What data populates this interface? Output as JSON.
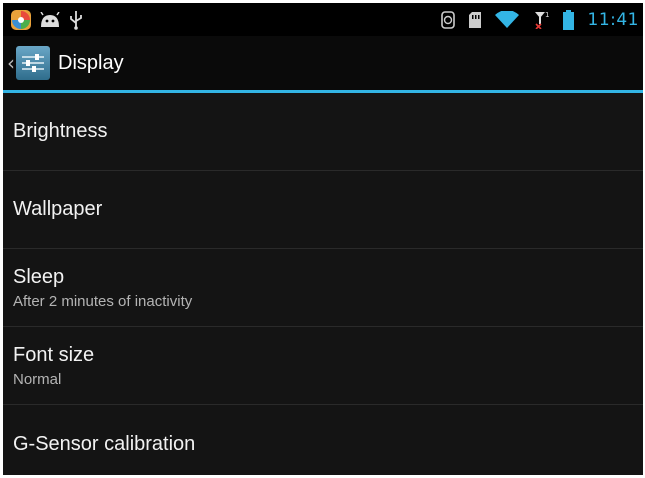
{
  "status_bar": {
    "left_icons": [
      "gallery-app-icon",
      "android-debug-icon",
      "usb-icon"
    ],
    "right_icons": [
      "nfc-icon",
      "sd-card-icon",
      "wifi-icon",
      "no-signal-icon",
      "battery-icon"
    ],
    "clock": "11:41",
    "accent_color": "#33b5e5"
  },
  "action_bar": {
    "up_glyph": "‹",
    "title": "Display",
    "icon": "settings-sliders-icon"
  },
  "settings": [
    {
      "label": "Brightness",
      "summary": ""
    },
    {
      "label": "Wallpaper",
      "summary": ""
    },
    {
      "label": "Sleep",
      "summary": "After 2 minutes of inactivity"
    },
    {
      "label": "Font size",
      "summary": "Normal"
    },
    {
      "label": "G-Sensor calibration",
      "summary": ""
    }
  ]
}
